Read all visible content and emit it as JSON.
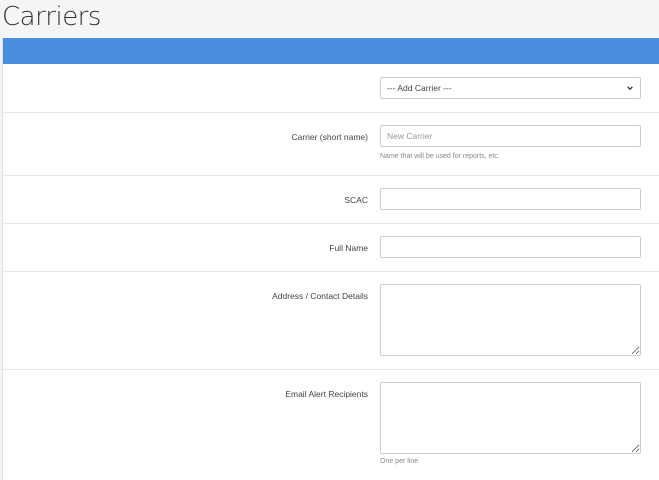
{
  "page": {
    "title": "Carriers"
  },
  "form": {
    "carrier_select": {
      "value": "--- Add Carrier ---"
    },
    "short_name": {
      "label": "Carrier (short name)",
      "placeholder": "New Carrier",
      "help": "Name that will be used for reports, etc."
    },
    "scac": {
      "label": "SCAC"
    },
    "full_name": {
      "label": "Full Name"
    },
    "address": {
      "label": "Address / Contact Details"
    },
    "email_alerts": {
      "label": "Email Alert Recipients",
      "help": "One per line"
    }
  },
  "colors": {
    "header_bar": "#4a8fdf",
    "background": "#f4f5f7",
    "panel": "#ffffff"
  },
  "icons": {
    "select_chevron": "chevron-down-icon"
  }
}
